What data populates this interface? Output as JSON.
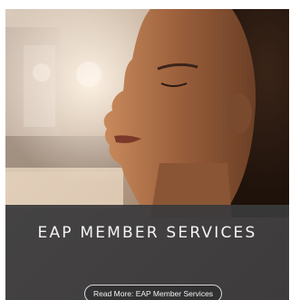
{
  "card": {
    "title": "EAP MEMBER SERVICES",
    "read_more_label": "Read More: EAP Member Services",
    "overlay_color": "#3a3a3c",
    "image_subject": "woman-eyes-closed-portrait"
  }
}
